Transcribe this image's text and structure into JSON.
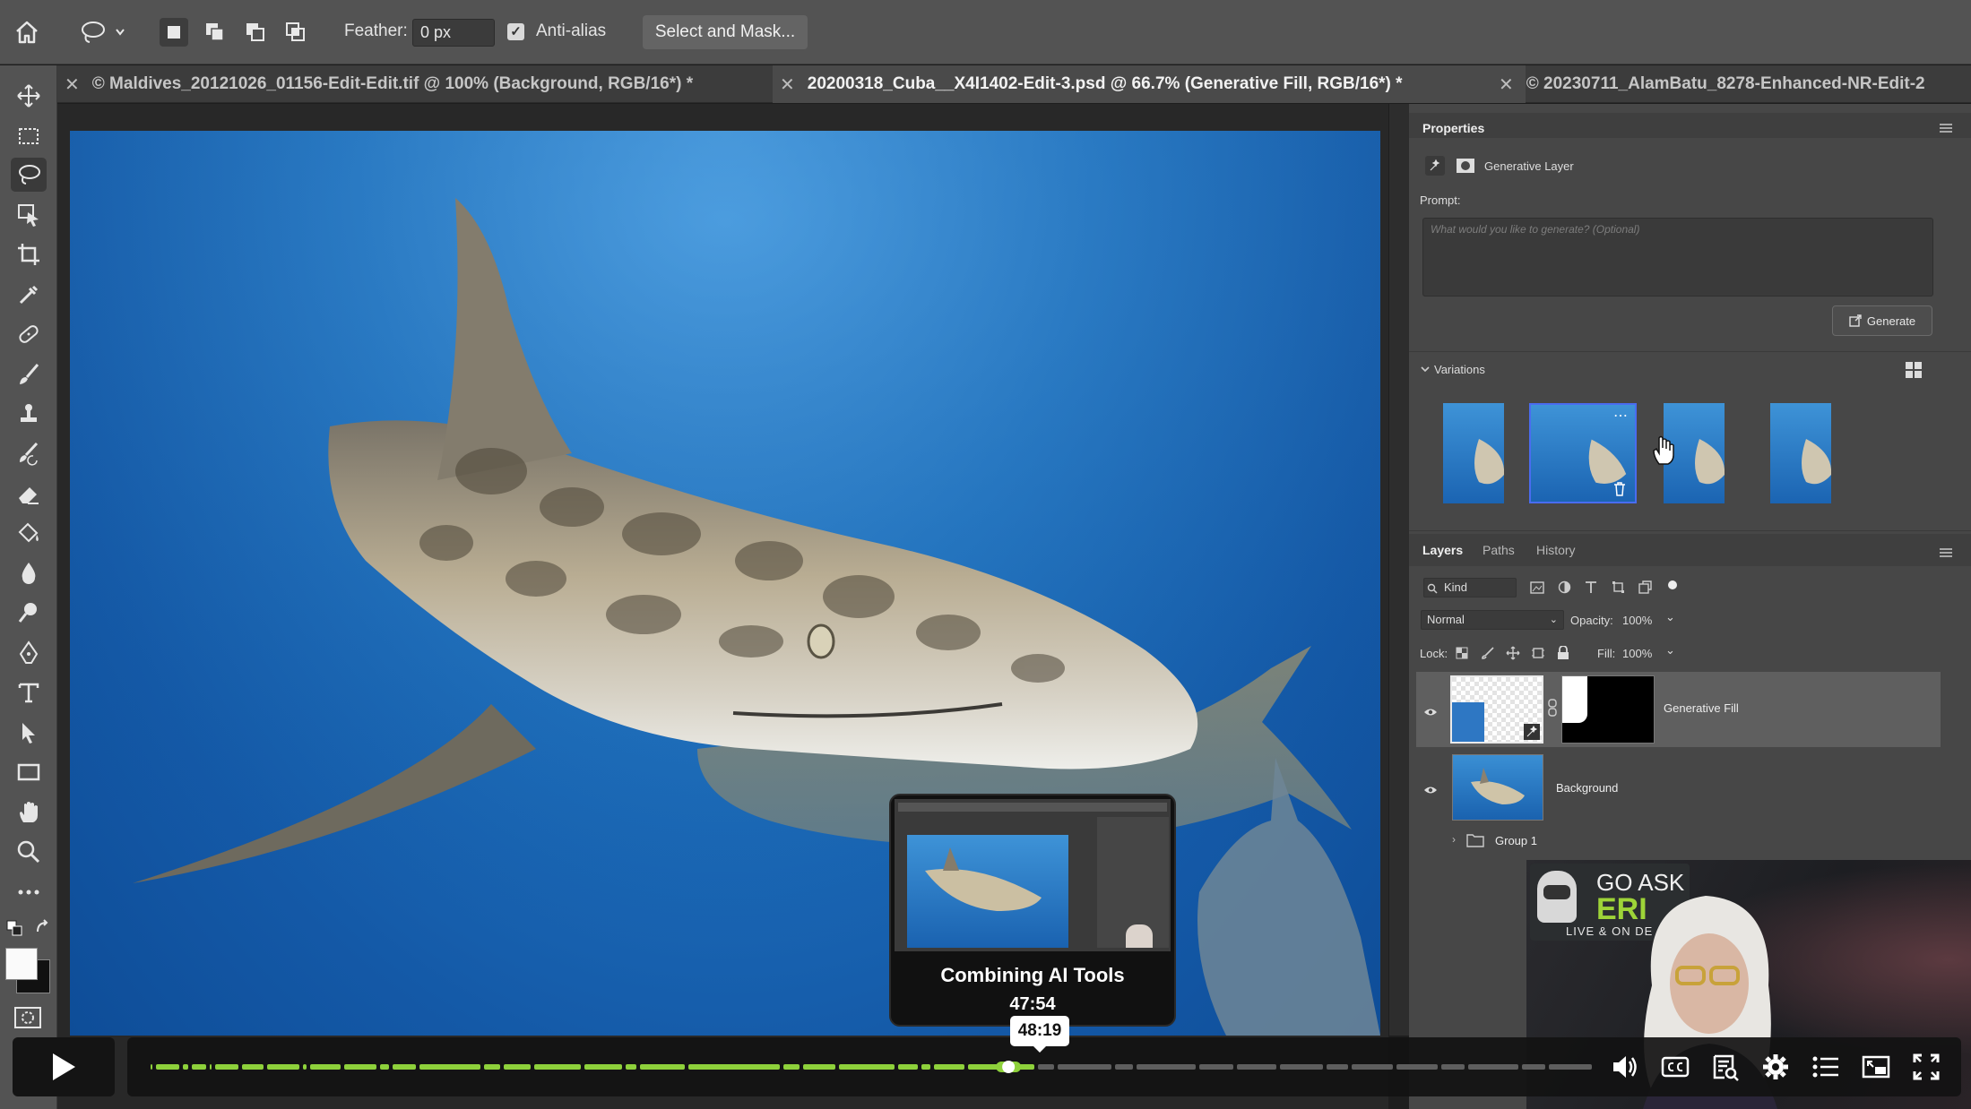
{
  "options_bar": {
    "feather_label": "Feather:",
    "feather_value": "0 px",
    "antialias_label": "Anti-alias",
    "antialias_checked": true,
    "select_mask_label": "Select and Mask..."
  },
  "tabs": [
    {
      "label": "© Maldives_20121026_01156-Edit-Edit.tif @ 100% (Background, RGB/16*) *",
      "active": false
    },
    {
      "label": "20200318_Cuba__X4I1402-Edit-3.psd @ 66.7% (Generative Fill, RGB/16*) *",
      "active": true
    },
    {
      "label": "© 20230711_AlamBatu_8278-Enhanced-NR-Edit-2",
      "active": false
    }
  ],
  "properties": {
    "title": "Properties",
    "layer_type": "Generative Layer",
    "prompt_label": "Prompt:",
    "prompt_placeholder": "What would you like to generate? (Optional)",
    "generate_label": "Generate",
    "variations_label": "Variations",
    "selected_variation_index": 1
  },
  "layers_panel": {
    "tabs": [
      "Layers",
      "Paths",
      "History"
    ],
    "active_tab": "Layers",
    "filter_kind": "Kind",
    "blend_mode": "Normal",
    "opacity_label": "Opacity:",
    "opacity_value": "100%",
    "lock_label": "Lock:",
    "fill_label": "Fill:",
    "fill_value": "100%",
    "layers": [
      {
        "name": "Generative Fill",
        "visible": true,
        "selected": true
      },
      {
        "name": "Background",
        "visible": true,
        "selected": false
      },
      {
        "name": "Group 1",
        "visible": false,
        "selected": false
      }
    ]
  },
  "webcam": {
    "logo_line1": "GO ASK",
    "logo_line2": "ERI",
    "logo_line3": "LIVE & ON DE"
  },
  "player": {
    "hover_time": "48:19",
    "preview_title": "Combining AI Tools",
    "preview_time": "47:54",
    "progress_fraction": 0.595,
    "accent_color": "#8ed13b"
  },
  "colors": {
    "ui_panel": "#474747",
    "ui_bar": "#535353",
    "water": "#1f73c0",
    "selection_blue": "#4a6cf0"
  }
}
